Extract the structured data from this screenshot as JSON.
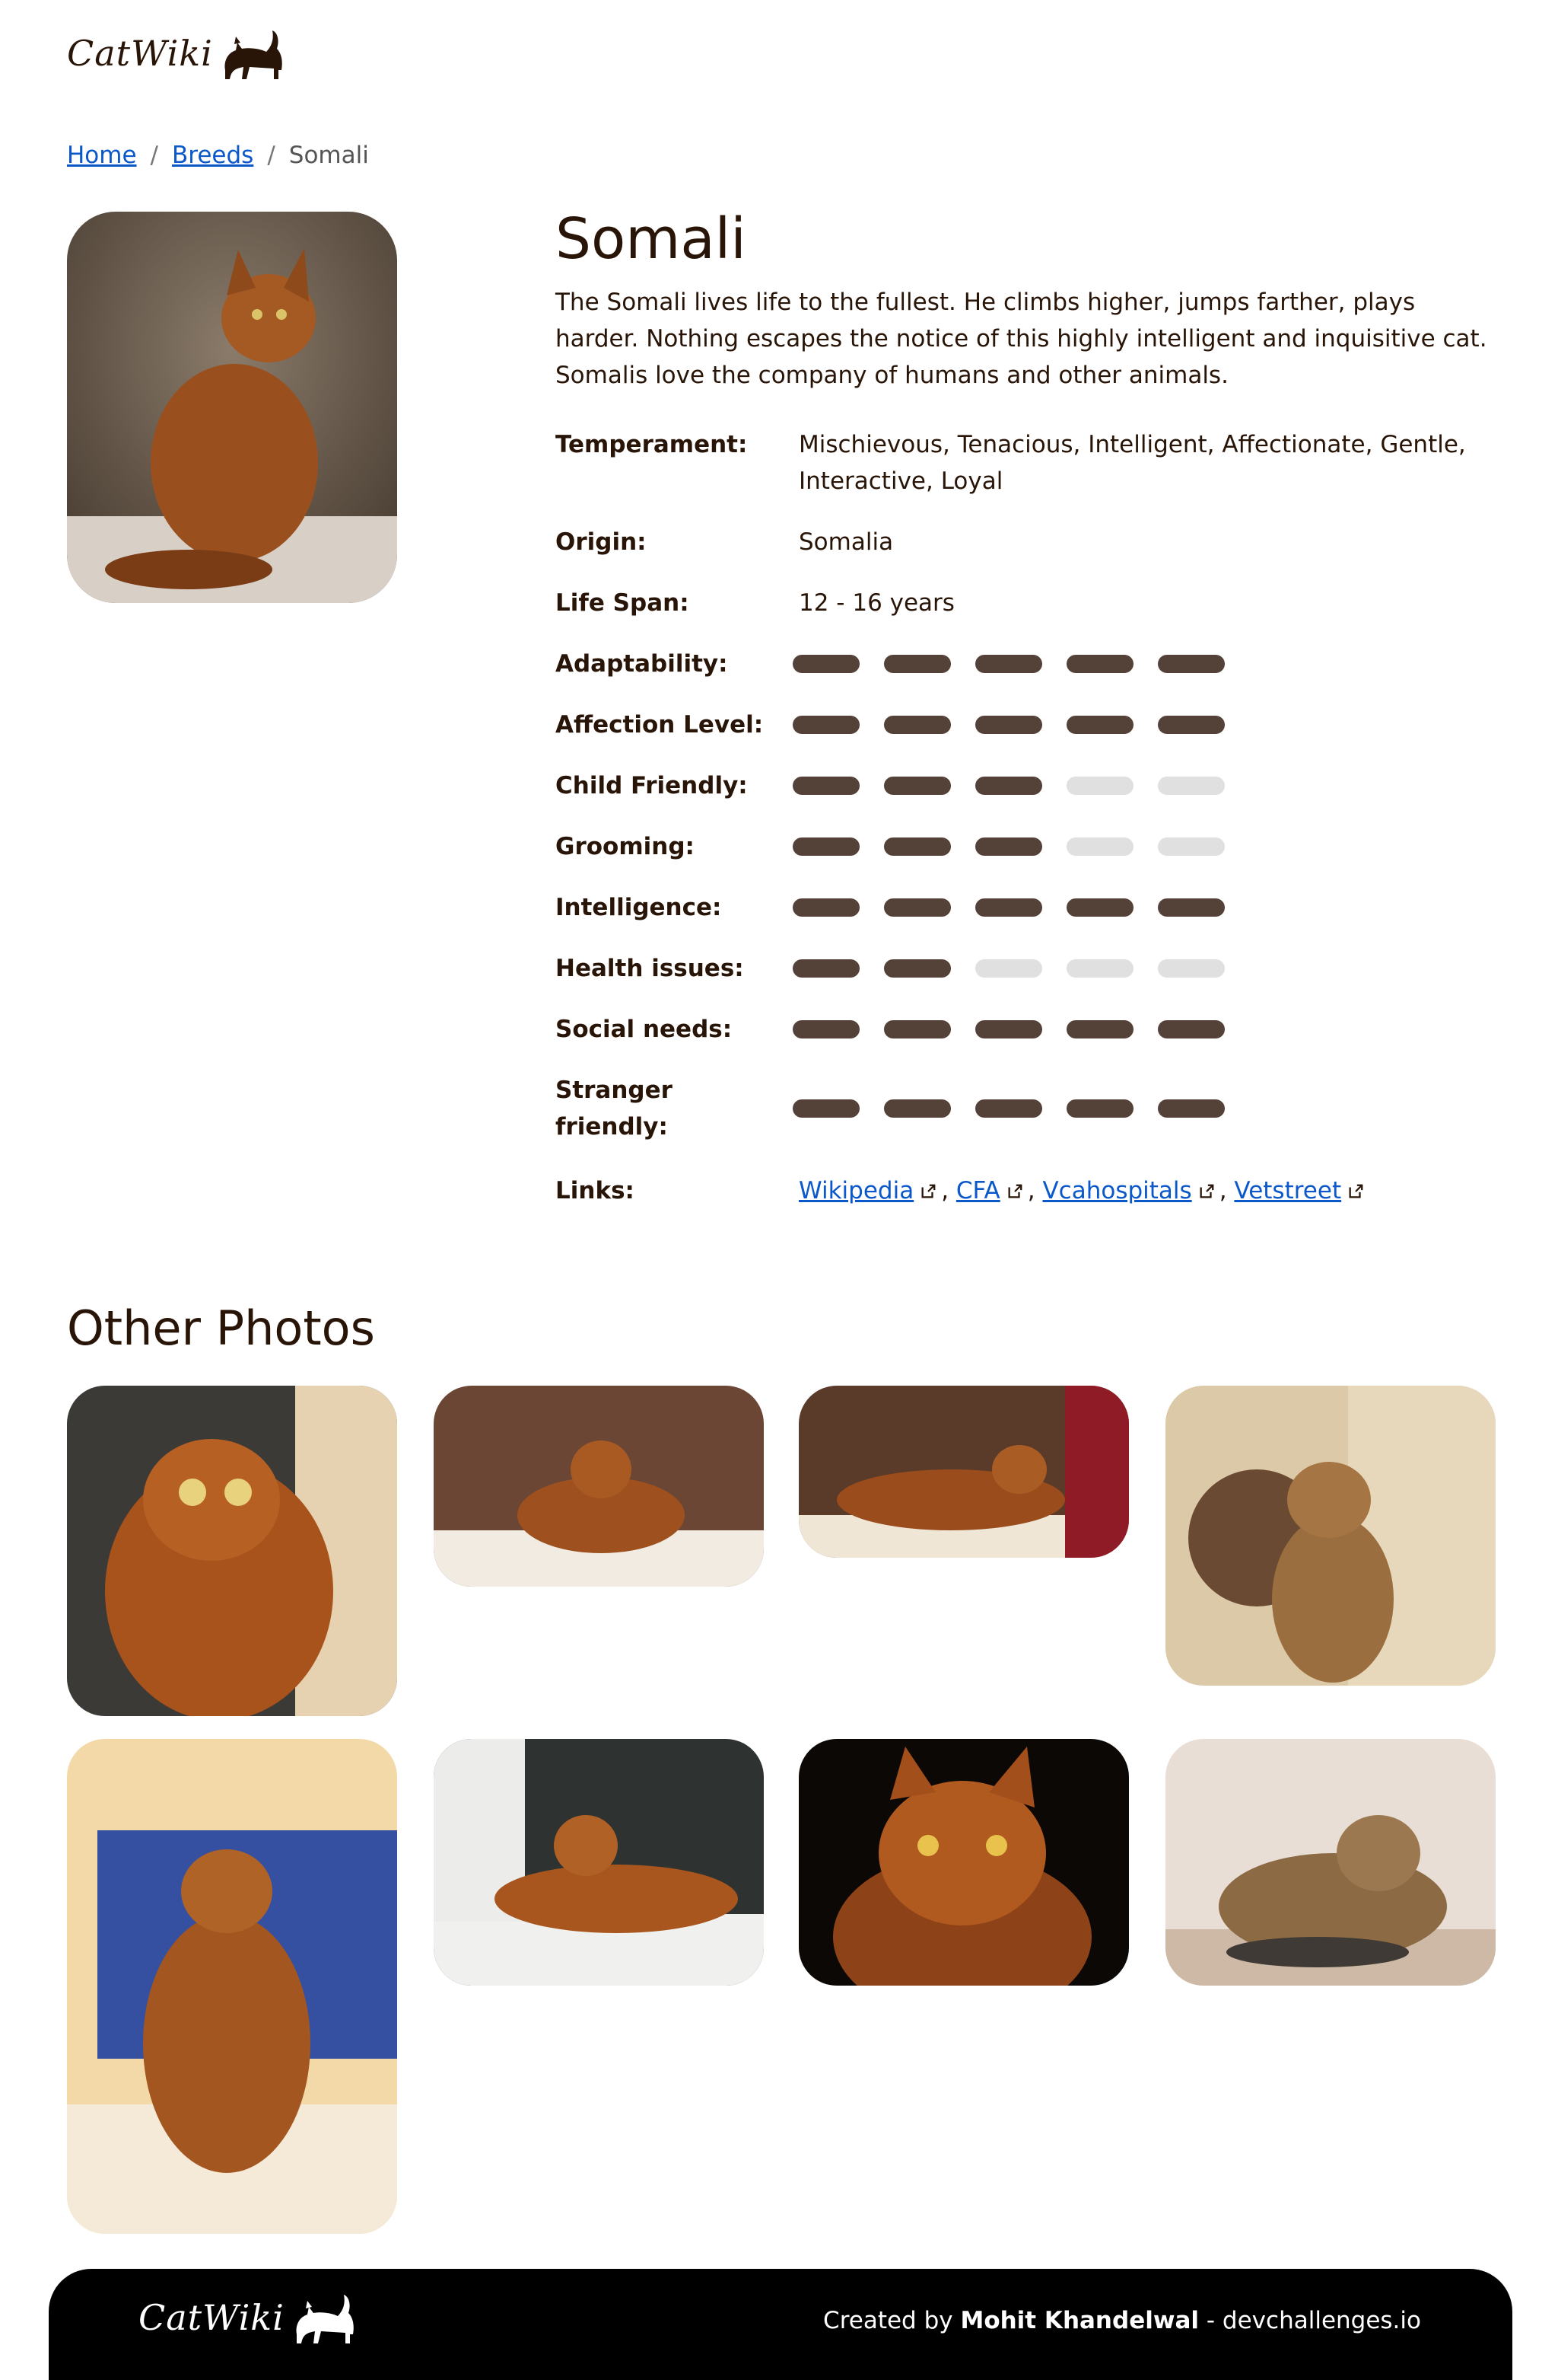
{
  "header": {
    "logo_text": "CatWiki"
  },
  "breadcrumb": {
    "home": "Home",
    "breeds": "Breeds",
    "current": "Somali"
  },
  "breed": {
    "name": "Somali",
    "description": "The Somali lives life to the fullest. He climbs higher, jumps farther, plays harder. Nothing escapes the notice of this highly intelligent and inquisitive cat. Somalis love the company of humans and other animals.",
    "temperament_label": "Temperament:",
    "temperament": "Mischievous, Tenacious, Intelligent, Affectionate, Gentle, Interactive, Loyal",
    "origin_label": "Origin:",
    "origin": "Somalia",
    "life_span_label": "Life Span:",
    "life_span": "12 - 16 years",
    "ratings": [
      {
        "label": "Adaptability:",
        "value": 5,
        "max": 5
      },
      {
        "label": "Affection Level:",
        "value": 5,
        "max": 5
      },
      {
        "label": "Child Friendly:",
        "value": 3,
        "max": 5
      },
      {
        "label": "Grooming:",
        "value": 3,
        "max": 5
      },
      {
        "label": "Intelligence:",
        "value": 5,
        "max": 5
      },
      {
        "label": "Health issues:",
        "value": 2,
        "max": 5
      },
      {
        "label": "Social needs:",
        "value": 5,
        "max": 5
      },
      {
        "label": "Stranger friendly:",
        "value": 5,
        "max": 5
      }
    ],
    "links_label": "Links:",
    "links": [
      "Wikipedia",
      "CFA",
      "Vcahospitals",
      "Vetstreet"
    ],
    "link_separator": ","
  },
  "other_photos": {
    "title": "Other Photos"
  },
  "footer": {
    "logo_text": "CatWiki",
    "credit_prefix": "Created by",
    "author": "Mohit Khandelwal",
    "credit_suffix": "- devchallenges.io"
  },
  "colors": {
    "brand_dark": "#291507",
    "bar_on": "#544239",
    "bar_off": "#e0e0e0",
    "link": "#0a58ca",
    "footer_bg": "#000000"
  }
}
